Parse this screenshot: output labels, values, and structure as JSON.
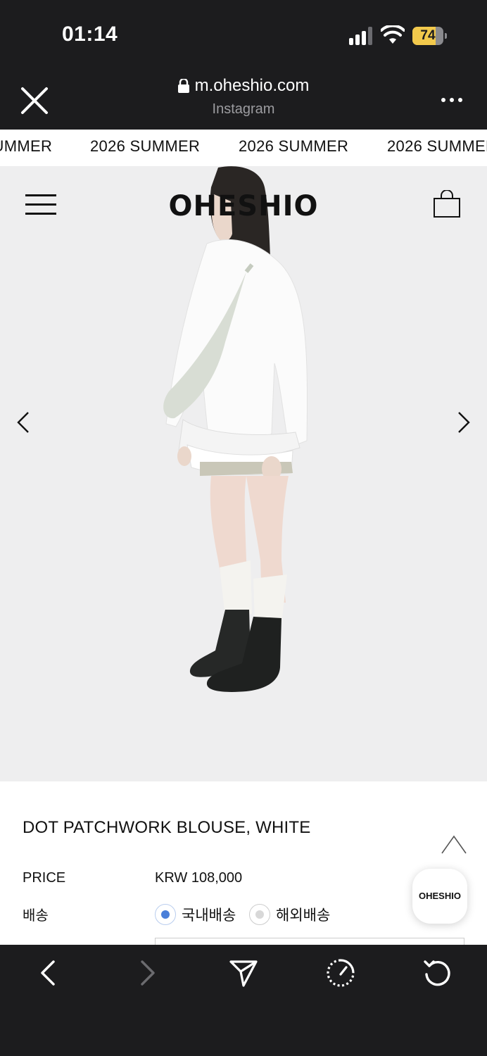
{
  "status_bar": {
    "time": "01:14",
    "battery_percent": "74",
    "battery_level": 0.74,
    "battery_color": "#f2c94c"
  },
  "browser": {
    "url": "m.oheshio.com",
    "subtitle": "Instagram",
    "close_icon": "close-icon",
    "more_icon": "more-icon"
  },
  "marquee": {
    "items": [
      "2026 SUMMER",
      "2026 SUMMER",
      "2026 SUMMER",
      "2026 SUMMER"
    ]
  },
  "site": {
    "logo": "OHESHIO",
    "menu_icon": "hamburger-icon",
    "cart_icon": "shopping-bag-icon"
  },
  "product": {
    "title": "DOT PATCHWORK BLOUSE, WHITE",
    "price_label": "PRICE",
    "price_value": "KRW 108,000",
    "shipping_label": "배송",
    "shipping_options": [
      {
        "label": "국내배송",
        "selected": true
      },
      {
        "label": "해외배송",
        "selected": false
      }
    ],
    "selected_color": "#4a7fd9"
  },
  "floating_button": {
    "label": "OHESHIO"
  },
  "toolbar": {
    "items": [
      "back-icon",
      "forward-icon",
      "share-icon",
      "speed-icon",
      "refresh-icon"
    ]
  }
}
